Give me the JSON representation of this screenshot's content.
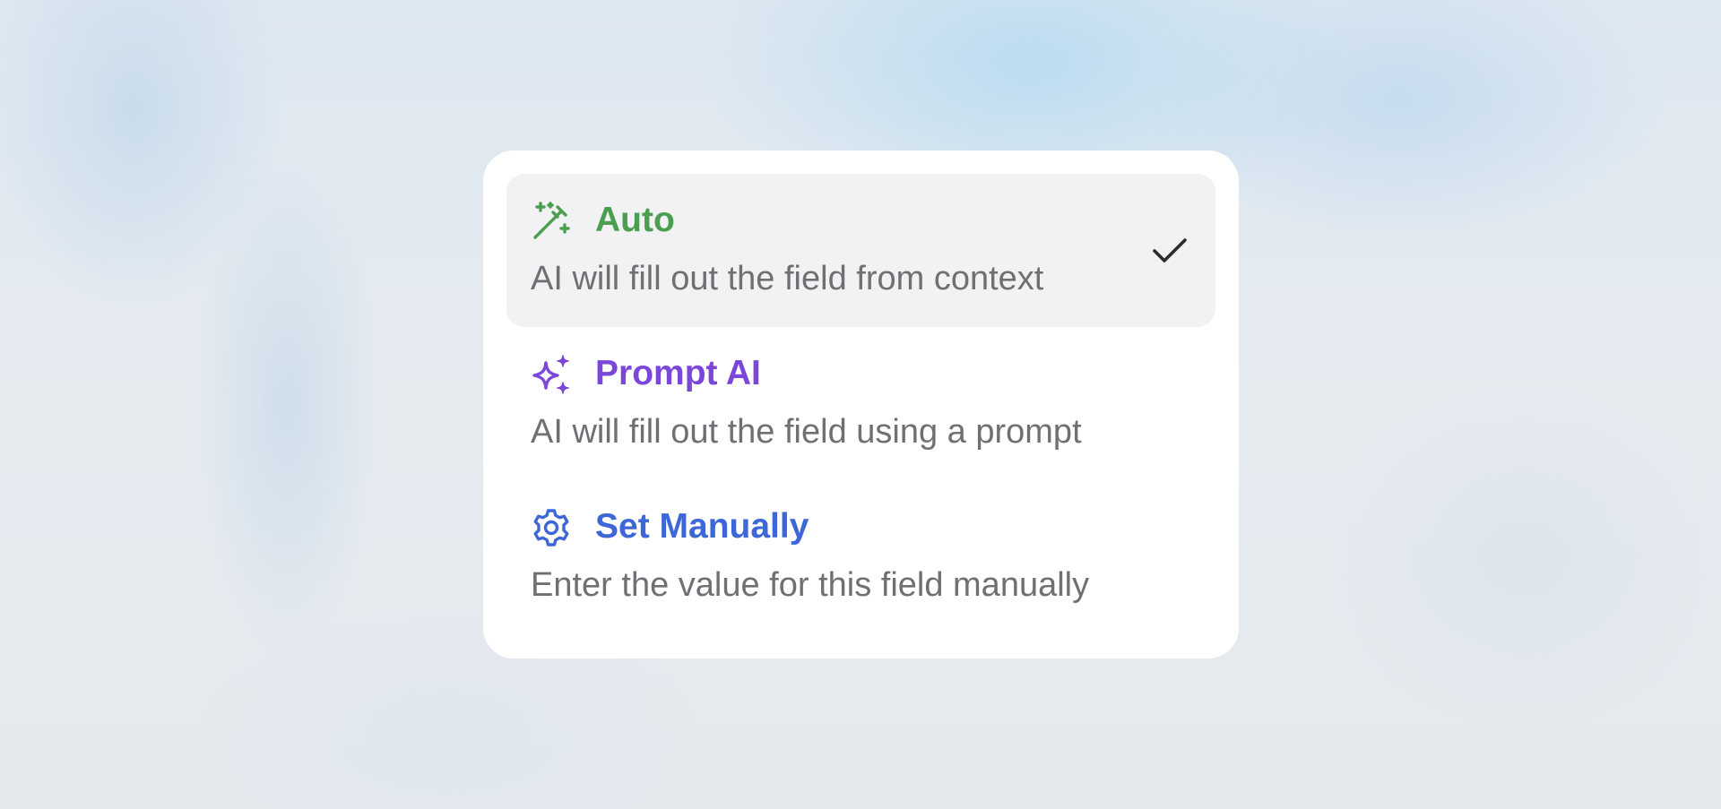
{
  "menu": {
    "options": [
      {
        "label": "Auto",
        "description": "AI will fill out the field from context",
        "icon": "magic-wand-icon",
        "color": "#4a9e4f",
        "selected": true
      },
      {
        "label": "Prompt AI",
        "description": "AI will fill out the field using a prompt",
        "icon": "sparkles-icon",
        "color": "#7b47d9",
        "selected": false
      },
      {
        "label": "Set Manually",
        "description": "Enter the value for this field manually",
        "icon": "gear-icon",
        "color": "#3d67d8",
        "selected": false
      }
    ],
    "selected_indicator_icon": "checkmark-icon"
  },
  "colors": {
    "menu_background": "#ffffff",
    "selected_background": "#f2f2f4",
    "description_text": "#6f6f74",
    "checkmark": "#2b2b30"
  }
}
